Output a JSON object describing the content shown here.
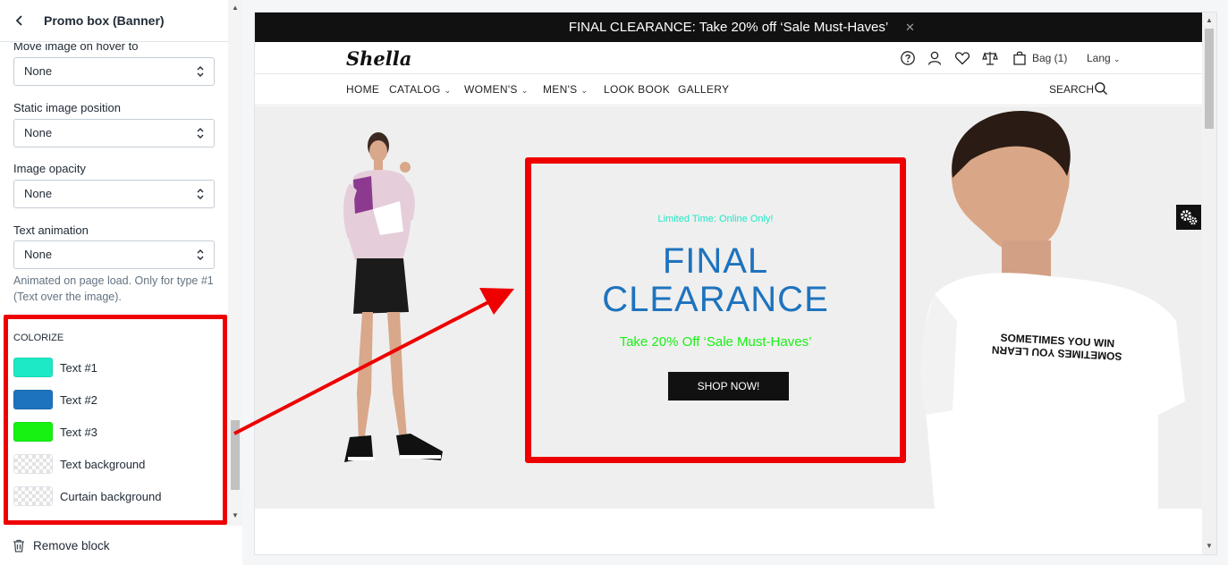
{
  "panel": {
    "title": "Promo box (Banner)",
    "fields": [
      {
        "label": "Move image on hover to",
        "value": "None"
      },
      {
        "label": "Static image position",
        "value": "None"
      },
      {
        "label": "Image opacity",
        "value": "None"
      },
      {
        "label": "Text animation",
        "value": "None"
      }
    ],
    "help_text": "Animated on page load. Only for type #1 (Text over the image).",
    "colorize": {
      "heading": "COLORIZE",
      "items": [
        {
          "label": "Text #1",
          "color": "#1de9c6"
        },
        {
          "label": "Text #2",
          "color": "#1e73be"
        },
        {
          "label": "Text #3",
          "color": "#17f213"
        },
        {
          "label": "Text background",
          "color": "transparent"
        },
        {
          "label": "Curtain background",
          "color": "transparent"
        }
      ]
    },
    "footer": {
      "remove_label": "Remove block"
    }
  },
  "store": {
    "announcement": "FINAL CLEARANCE: Take 20% off ‘Sale Must-Haves’",
    "logo": "Shella",
    "header": {
      "bag_label": "Bag (1)",
      "lang_label": "Lang"
    },
    "nav": [
      {
        "label": "HOME",
        "dropdown": false
      },
      {
        "label": "CATALOG",
        "dropdown": true
      },
      {
        "label": "WOMEN'S",
        "dropdown": true
      },
      {
        "label": "MEN'S",
        "dropdown": true
      },
      {
        "label": "LOOK BOOK",
        "dropdown": false
      },
      {
        "label": "GALLERY",
        "dropdown": false
      }
    ],
    "search_label": "SEARCH",
    "promo": {
      "small_text": "Limited Time: Online Only!",
      "title": "FINAL CLEARANCE",
      "title_line1": "FINAL",
      "title_line2": "CLEARANCE",
      "subtitle": "Take 20% Off ‘Sale Must-Haves’",
      "button": "SHOP NOW!"
    },
    "tee_print": {
      "line1": "SOMETIMES YOU WIN",
      "line2": "SOMETIMES YOU LEARN"
    }
  },
  "colors": {
    "highlight": "#ee0000",
    "text1": "#1de9c6",
    "text2": "#1e73be",
    "text3": "#17f213"
  }
}
